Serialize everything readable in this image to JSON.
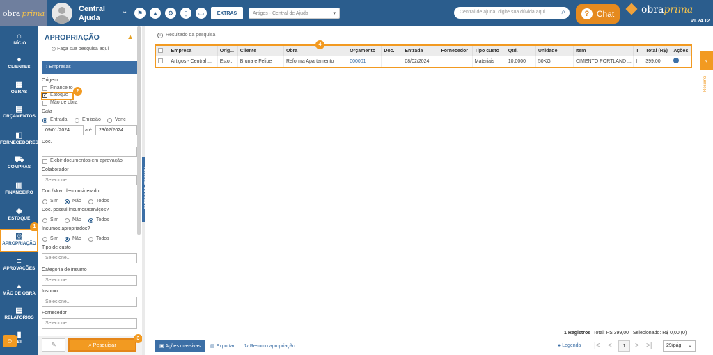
{
  "header": {
    "logo_text": "obra",
    "logo_italic": "prima",
    "user_name": "Central Ajuda",
    "extras_label": "EXTRAS",
    "company_select": "Artigos - Central de Ajuda",
    "search_placeholder": "Central de ajuda: digite sua dúvida aqui...",
    "chat_label": "Chat",
    "brand_text": "obra",
    "brand_italic": "prima",
    "version": "v1.24.12"
  },
  "sidebar": {
    "items": [
      {
        "label": "INÍCIO",
        "icon": "home-icon",
        "glyph": "⌂"
      },
      {
        "label": "CLIENTES",
        "icon": "user-icon",
        "glyph": "●"
      },
      {
        "label": "OBRAS",
        "icon": "building-icon",
        "glyph": "▦"
      },
      {
        "label": "ORÇAMENTOS",
        "icon": "document-icon",
        "glyph": "▤"
      },
      {
        "label": "FORNECEDORES",
        "icon": "truck-icon",
        "glyph": "◧"
      },
      {
        "label": "COMPRAS",
        "icon": "cart-icon",
        "glyph": "⛟"
      },
      {
        "label": "FINANCEIRO",
        "icon": "calculator-icon",
        "glyph": "▥"
      },
      {
        "label": "ESTOQUE",
        "icon": "boxes-icon",
        "glyph": "◈"
      },
      {
        "label": "APROPRIAÇÃO",
        "icon": "file-export-icon",
        "glyph": "▧"
      },
      {
        "label": "APROVAÇÕES",
        "icon": "checklist-icon",
        "glyph": "≡"
      },
      {
        "label": "MÃO DE OBRA",
        "icon": "worker-icon",
        "glyph": "▲"
      },
      {
        "label": "RELATÓRIOS",
        "icon": "report-icon",
        "glyph": "▤"
      },
      {
        "label": "BI",
        "icon": "chart-icon",
        "glyph": "▮"
      }
    ]
  },
  "badges": {
    "b1": "1",
    "b2": "2",
    "b3": "3",
    "b4": "4"
  },
  "panel": {
    "title": "APROPRIAÇÃO",
    "subtitle": "Faça sua pesquisa aqui",
    "empresas": "Empresas",
    "origem_label": "Origem",
    "origem_financeiro": "Financeiro",
    "origem_estoque": "Estoque",
    "origem_mao": "Mão de obra",
    "data_label": "Data",
    "data_entrada": "Entrada",
    "data_emissao": "Emissão",
    "data_venc": "Venc",
    "date_from": "09/01/2024",
    "ate": "até",
    "date_to": "23/02/2024",
    "doc_label": "Doc.",
    "exibir_docs": "Exibir documentos em aprovação",
    "colaborador_label": "Colaborador",
    "selecione": "Selecione...",
    "desconsiderado_label": "Doc./Mov. desconsiderado",
    "insumos_servicos_label": "Doc. possui insumos/serviços?",
    "apropriados_label": "Insumos apropriados?",
    "sim": "Sim",
    "nao": "Não",
    "todos": "Todos",
    "tipo_custo_label": "Tipo de custo",
    "categoria_label": "Categoria de insumo",
    "insumo_label": "Insumo",
    "fornecedor_label": "Fornecedor",
    "pesquisar": "Pesquisar",
    "filtros_tab": "FILTROS DE PESQUISA"
  },
  "results": {
    "heading": "Resultado da pesquisa",
    "columns": [
      "Empresa",
      "Orig...",
      "Cliente",
      "Obra",
      "Orçamento",
      "Doc.",
      "Entrada",
      "Fornecedor",
      "Tipo custo",
      "Qtd.",
      "Unidade",
      "Item",
      "T",
      "Total (R$)",
      "Ações"
    ],
    "rows": [
      [
        "Artigos - Central ...",
        "Esto...",
        "Bruna e Felipe",
        "Reforma Apartamento",
        "000001",
        "",
        "08/02/2024",
        "",
        "Materiais",
        "10,0000",
        "50KG",
        "CIMENTO PORTLAND ...",
        "I",
        "399,00",
        ""
      ]
    ]
  },
  "footer": {
    "acoes_massivas": "Ações massivas",
    "exportar": "Exportar",
    "resumo_apropriacao": "Resumo apropriação",
    "legenda": "Legenda",
    "registros": "1 Registros",
    "total": "Total: R$ 399,00",
    "selecionado": "Selecionado: R$ 0,00 (0)",
    "page": "1",
    "per_page": "29/pág."
  },
  "right_sidebar": {
    "resumo": "Resumo"
  },
  "colors": {
    "primary": "#2b5d8d",
    "accent": "#f29a21",
    "link": "#3c6fa6"
  }
}
